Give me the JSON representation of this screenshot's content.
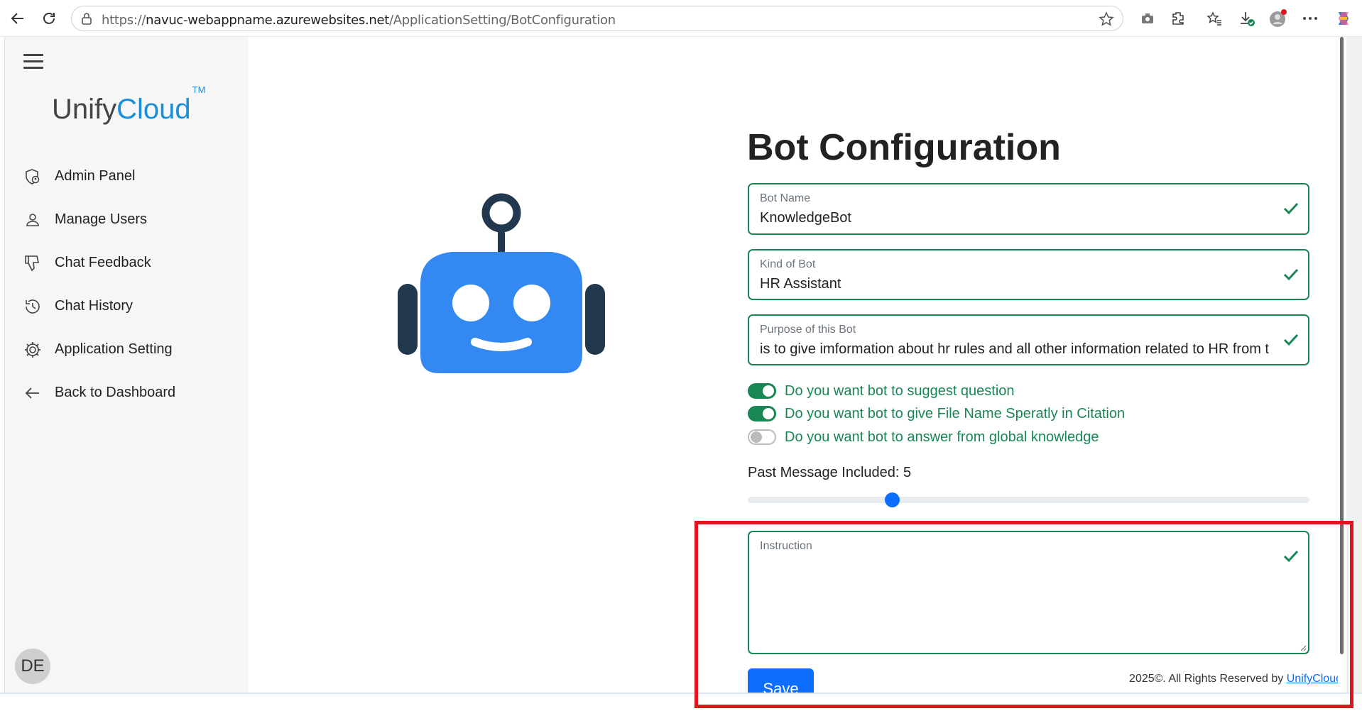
{
  "browser": {
    "url_prefix": "https://",
    "url_host": "navuc-webappname.azurewebsites.net",
    "url_path": "/ApplicationSetting/BotConfiguration"
  },
  "sidebar": {
    "brand_unify": "Unify",
    "brand_cloud": "Cloud",
    "brand_tm": "TM",
    "items": [
      {
        "label": "Admin Panel",
        "icon": "shield-person-icon"
      },
      {
        "label": "Manage Users",
        "icon": "person-icon"
      },
      {
        "label": "Chat Feedback",
        "icon": "thumbs-down-icon"
      },
      {
        "label": "Chat History",
        "icon": "history-icon"
      },
      {
        "label": "Application Setting",
        "icon": "gear-icon"
      },
      {
        "label": "Back to Dashboard",
        "icon": "arrow-left-icon"
      }
    ],
    "avatar_initials": "DE"
  },
  "main": {
    "title": "Bot Configuration",
    "fields": {
      "bot_name": {
        "label": "Bot Name",
        "value": "KnowledgeBot"
      },
      "kind_of_bot": {
        "label": "Kind of Bot",
        "value": "HR Assistant"
      },
      "purpose": {
        "label": "Purpose of this Bot",
        "value": "is to give imformation about hr rules and all other information related to HR from t"
      },
      "instruction": {
        "label": "Instruction",
        "value": ""
      }
    },
    "toggles": [
      {
        "label": "Do you want bot to suggest question",
        "on": true
      },
      {
        "label": "Do you want bot to give File Name Speratly in Citation",
        "on": true
      },
      {
        "label": "Do you want bot to answer from global knowledge",
        "on": false
      }
    ],
    "slider": {
      "label": "Past Message Included: 5",
      "value": 5,
      "min": 0,
      "max": 20
    },
    "save_label": "Save",
    "footer_text": "2025©. All Rights Reserved by ",
    "footer_link": "UnifyCloud"
  },
  "colors": {
    "accent": "#0d6efd",
    "success": "#198754",
    "robot_face": "#3388f2",
    "robot_dark": "#22384f",
    "highlight": "#e0161e"
  }
}
